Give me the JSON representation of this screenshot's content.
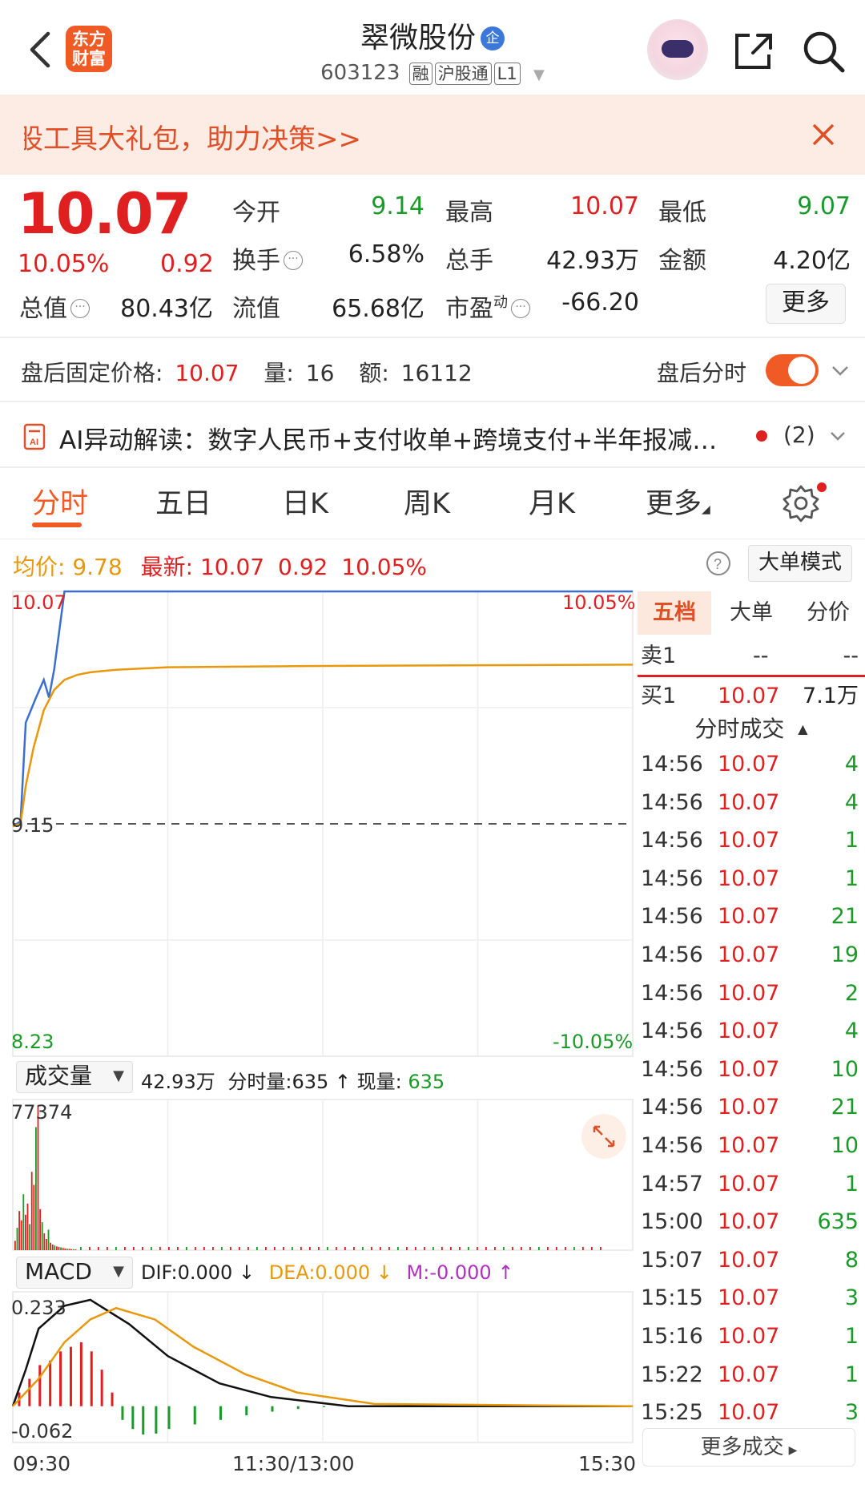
{
  "header": {
    "logo_line1": "东方",
    "logo_line2": "财富",
    "stock_name": "翠微股份",
    "name_badge": "企",
    "stock_code": "603123",
    "tags": [
      "融",
      "沪股通",
      "L1"
    ]
  },
  "banner": {
    "text": "股工具大礼包，助力决策>>"
  },
  "quote": {
    "price": "10.07",
    "change_pct": "10.05%",
    "change": "0.92",
    "open_label": "今开",
    "open": "9.14",
    "high_label": "最高",
    "high": "10.07",
    "low_label": "最低",
    "low": "9.07",
    "turnover_label": "换手",
    "turnover": "6.58%",
    "volume_label": "总手",
    "volume": "42.93万",
    "amount_label": "金额",
    "amount": "4.20亿",
    "mktcap_label": "总值",
    "mktcap": "80.43亿",
    "float_label": "流值",
    "float": "65.68亿",
    "pe_label": "市盈",
    "pe_sup": "动",
    "pe": "-66.20",
    "more_label": "更多"
  },
  "after_hours": {
    "price_label": "盘后固定价格:",
    "price": "10.07",
    "vol_label": "量:",
    "vol": "16",
    "amt_label": "额:",
    "amt": "16112",
    "switch_label": "盘后分时",
    "switch_on": true
  },
  "ai": {
    "text": "AI异动解读：数字人民币+支付收单+跨境支付+半年报减…",
    "count": "(2)"
  },
  "tabs": [
    "分时",
    "五日",
    "日K",
    "周K",
    "月K",
    "更多"
  ],
  "chart_header": {
    "avg_label": "均价:",
    "avg": "9.78",
    "latest_label": "最新:",
    "latest": "10.07",
    "latest_chg": "0.92",
    "latest_pct": "10.05%",
    "big_order_btn": "大单模式"
  },
  "colors": {
    "up": "#e02020",
    "down": "#1a9a28",
    "accent": "#f05a24",
    "avg_line": "#e8980c",
    "price_line": "#3a6fd0"
  },
  "chart_data": [
    {
      "type": "line",
      "title": "分时",
      "y_top_label": "10.07",
      "y_bottom_label": "8.23",
      "y_mid_label": "9.15",
      "pct_top_label": "10.05%",
      "pct_bottom_label": "-10.05%",
      "ylim": [
        8.23,
        10.07
      ],
      "prev_close": 9.15,
      "x_labels": [
        "09:30",
        "11:30/13:00",
        "15:30"
      ],
      "series": [
        {
          "name": "最新",
          "x": [
            0,
            3,
            5,
            7,
            9,
            12,
            14,
            16,
            20,
            25,
            30,
            60,
            120,
            240,
            300
          ],
          "values": [
            9.14,
            9.16,
            9.55,
            9.6,
            9.65,
            9.72,
            9.65,
            9.76,
            10.07,
            10.07,
            10.07,
            10.07,
            10.07,
            10.07,
            10.07
          ]
        },
        {
          "name": "均价",
          "x": [
            0,
            3,
            5,
            8,
            12,
            16,
            20,
            25,
            30,
            40,
            60,
            120,
            240,
            300
          ],
          "values": [
            9.14,
            9.15,
            9.3,
            9.45,
            9.6,
            9.68,
            9.72,
            9.74,
            9.75,
            9.76,
            9.77,
            9.775,
            9.78,
            9.78
          ]
        }
      ]
    },
    {
      "type": "bar",
      "title": "成交量",
      "total": "42.93万",
      "minute_vol_label": "分时量:",
      "minute_vol": "635",
      "current_vol_label": "现量:",
      "current_vol": "635",
      "ylim_label": "77374",
      "ylim": [
        0,
        77374
      ],
      "values": [
        5000,
        12000,
        21000,
        16000,
        30000,
        19000,
        25000,
        14000,
        42000,
        35000,
        66000,
        77374,
        22000,
        15000,
        9000,
        6000,
        11000,
        4000,
        3000,
        2500,
        2000,
        1800,
        1500,
        1200,
        1000,
        800,
        700,
        600,
        500,
        400
      ]
    },
    {
      "type": "line",
      "title": "MACD",
      "dif_label": "DIF:",
      "dif": "0.000",
      "dea_label": "DEA:",
      "dea": "0.000",
      "m_label": "M:",
      "m": "-0.000",
      "y_top_label": "0.233",
      "y_bottom_label": "-0.062",
      "ylim": [
        -0.062,
        0.233
      ],
      "series": [
        {
          "name": "DIF",
          "x": [
            0,
            5,
            10,
            20,
            30,
            45,
            60,
            80,
            100,
            130,
            300
          ],
          "values": [
            0.0,
            0.08,
            0.17,
            0.22,
            0.233,
            0.18,
            0.11,
            0.05,
            0.02,
            0.0,
            0.0
          ]
        },
        {
          "name": "DEA",
          "x": [
            0,
            10,
            20,
            30,
            40,
            55,
            70,
            90,
            110,
            140,
            300
          ],
          "values": [
            0.0,
            0.06,
            0.14,
            0.19,
            0.215,
            0.19,
            0.13,
            0.07,
            0.03,
            0.005,
            0.0
          ]
        }
      ],
      "macd_bars_x": [
        2,
        6,
        10,
        14,
        18,
        22,
        26,
        30,
        34,
        38,
        42,
        46,
        50,
        55,
        60,
        70,
        80,
        90,
        100,
        110,
        120
      ],
      "macd_bars": [
        0.03,
        0.06,
        0.09,
        0.1,
        0.12,
        0.13,
        0.14,
        0.12,
        0.08,
        0.03,
        -0.03,
        -0.05,
        -0.062,
        -0.06,
        -0.05,
        -0.04,
        -0.03,
        -0.02,
        -0.012,
        -0.006,
        -0.002
      ]
    }
  ],
  "order_book": {
    "tabs": [
      "五档",
      "大单",
      "分价"
    ],
    "sell1_label": "卖1",
    "sell1_price": "--",
    "sell1_vol": "--",
    "buy1_label": "买1",
    "buy1_price": "10.07",
    "buy1_vol": "7.1万"
  },
  "trades": {
    "header": "分时成交",
    "rows": [
      {
        "time": "14:56",
        "price": "10.07",
        "vol": "4"
      },
      {
        "time": "14:56",
        "price": "10.07",
        "vol": "4"
      },
      {
        "time": "14:56",
        "price": "10.07",
        "vol": "1"
      },
      {
        "time": "14:56",
        "price": "10.07",
        "vol": "1"
      },
      {
        "time": "14:56",
        "price": "10.07",
        "vol": "21"
      },
      {
        "time": "14:56",
        "price": "10.07",
        "vol": "19"
      },
      {
        "time": "14:56",
        "price": "10.07",
        "vol": "2"
      },
      {
        "time": "14:56",
        "price": "10.07",
        "vol": "4"
      },
      {
        "time": "14:56",
        "price": "10.07",
        "vol": "10"
      },
      {
        "time": "14:56",
        "price": "10.07",
        "vol": "21"
      },
      {
        "time": "14:56",
        "price": "10.07",
        "vol": "10"
      },
      {
        "time": "14:57",
        "price": "10.07",
        "vol": "1"
      },
      {
        "time": "15:00",
        "price": "10.07",
        "vol": "635"
      },
      {
        "time": "15:07",
        "price": "10.07",
        "vol": "8"
      },
      {
        "time": "15:15",
        "price": "10.07",
        "vol": "3"
      },
      {
        "time": "15:16",
        "price": "10.07",
        "vol": "1"
      },
      {
        "time": "15:22",
        "price": "10.07",
        "vol": "1"
      },
      {
        "time": "15:25",
        "price": "10.07",
        "vol": "3"
      }
    ],
    "more_label": "更多成交"
  }
}
